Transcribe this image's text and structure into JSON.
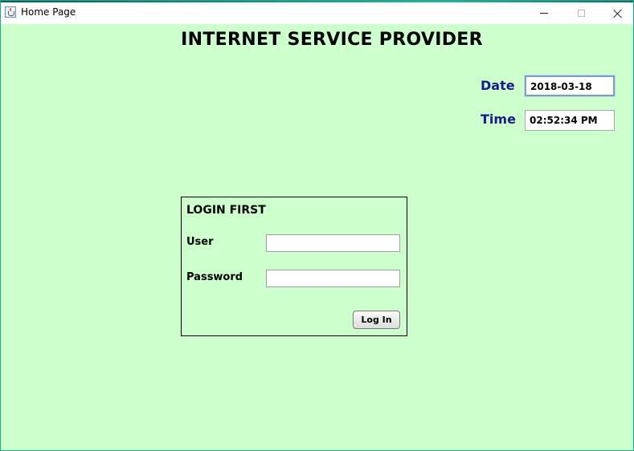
{
  "window": {
    "title": "Home Page"
  },
  "header": {
    "heading": "INTERNET SERVICE PROVIDER"
  },
  "datetime": {
    "date_label": "Date",
    "date_value": "2018-03-18",
    "time_label": "Time",
    "time_value": "02:52:34 PM"
  },
  "login": {
    "title": "LOGIN FIRST",
    "user_label": "User",
    "user_value": "",
    "password_label": "Password",
    "password_value": "",
    "button_label": "Log In"
  },
  "colors": {
    "background": "#ccffcc",
    "label_accent": "#1a1a8c",
    "window_border": "#1aa88e"
  },
  "icons": {
    "app": "java-cup-icon",
    "minimize": "minimize-icon",
    "maximize": "maximize-icon",
    "close": "close-icon"
  }
}
